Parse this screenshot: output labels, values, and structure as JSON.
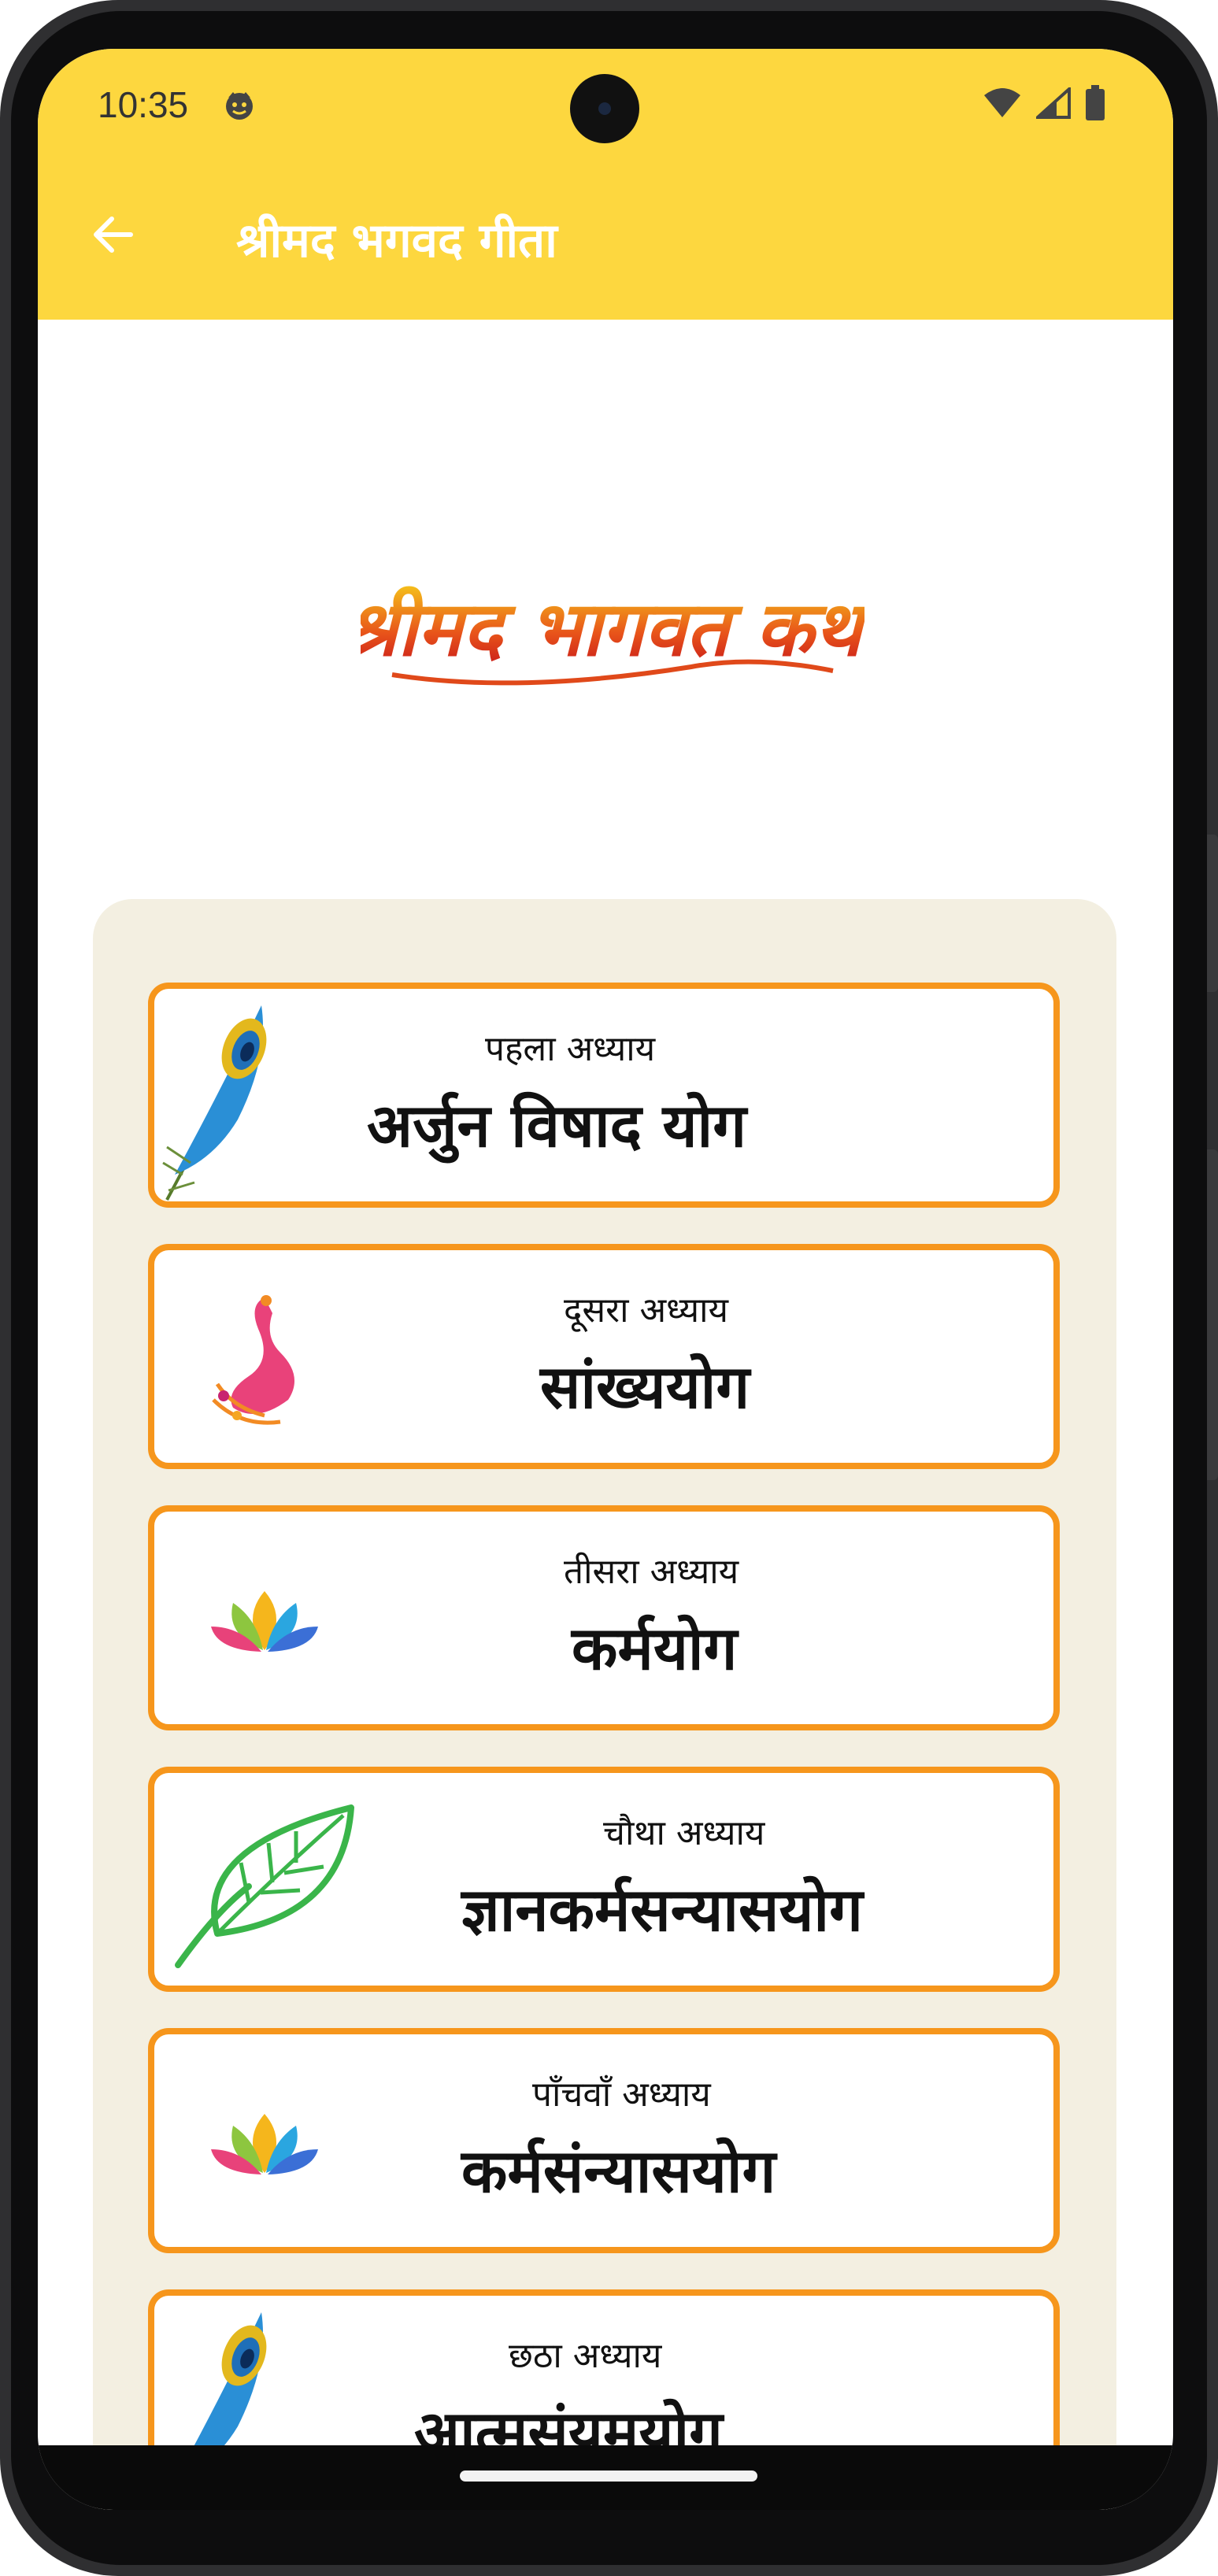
{
  "status": {
    "time": "10:35"
  },
  "appbar": {
    "title": "श्रीमद भगवद गीता"
  },
  "logo": {
    "text": "श्रीमद भागवत कथा"
  },
  "chapters": [
    {
      "number_label": "पहला अध्याय",
      "name": "अर्जुन विषाद योग",
      "icon": "peacock-feather-icon"
    },
    {
      "number_label": "दूसरा अध्याय",
      "name": "सांख्ययोग",
      "icon": "peacock-icon"
    },
    {
      "number_label": "तीसरा अध्याय",
      "name": "कर्मयोग",
      "icon": "lotus-icon"
    },
    {
      "number_label": "चौथा अध्याय",
      "name": "ज्ञानकर्मसन्यासयोग",
      "icon": "leaf-icon"
    },
    {
      "number_label": "पाँचवाँ अध्याय",
      "name": "कर्मसंन्यासयोग",
      "icon": "lotus-icon"
    },
    {
      "number_label": "छठा अध्याय",
      "name": "आत्मसंयमयोग",
      "icon": "peacock-feather-icon"
    }
  ],
  "colors": {
    "appbar": "#fdd73f",
    "card_border": "#f6961c",
    "panel": "#f3efe1"
  }
}
